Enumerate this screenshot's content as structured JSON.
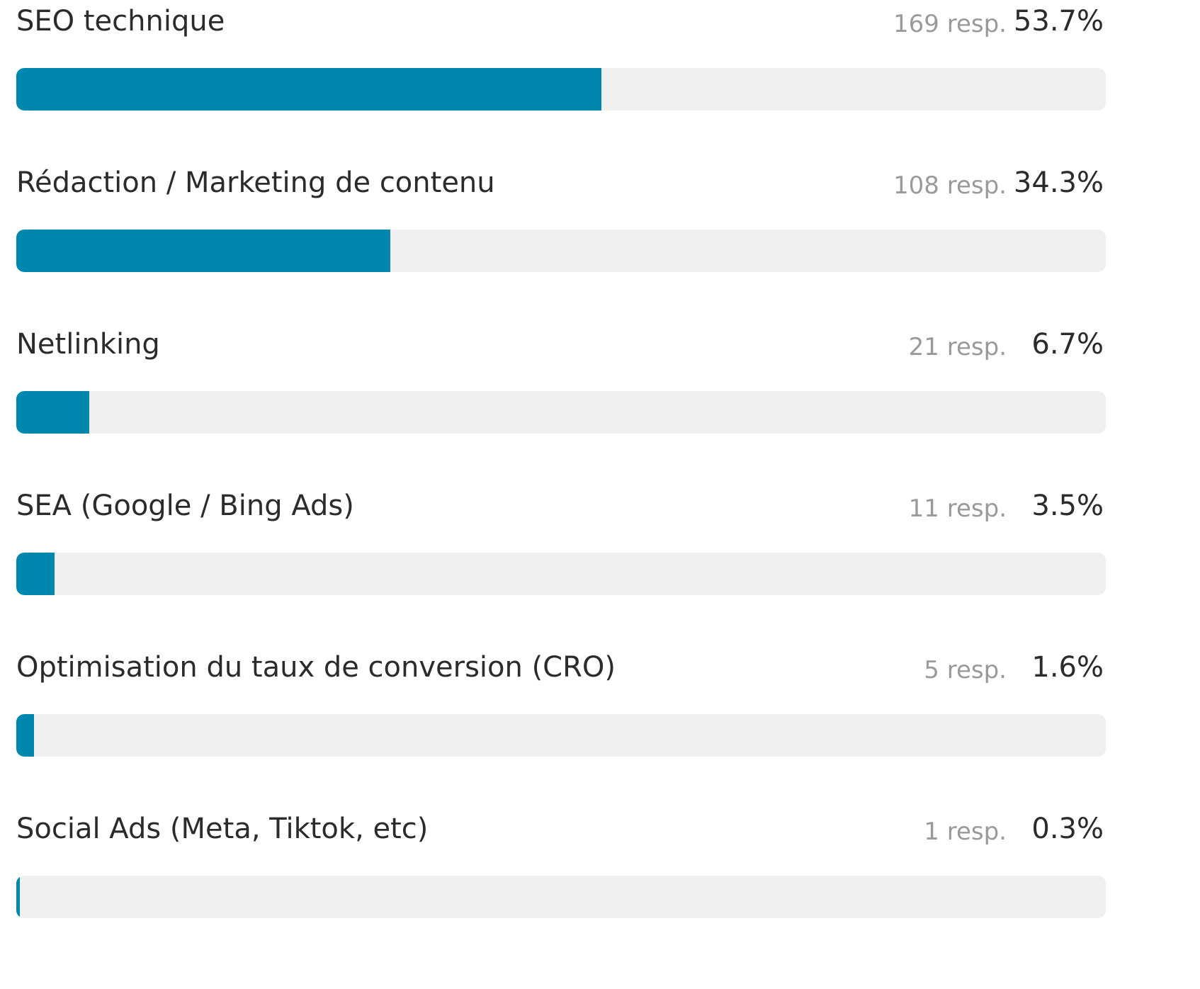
{
  "chart_data": {
    "type": "bar",
    "orientation": "horizontal",
    "bar_color": "#0087ae",
    "track_color": "#f0f0f0",
    "categories": [
      "SEO technique",
      "Rédaction / Marketing de contenu",
      "Netlinking",
      "SEA (Google / Bing Ads)",
      "Optimisation du taux de conversion (CRO)",
      "Social Ads (Meta, Tiktok, etc)"
    ],
    "responses": [
      169,
      108,
      21,
      11,
      5,
      1
    ],
    "values": [
      53.7,
      34.3,
      6.7,
      3.5,
      1.6,
      0.3
    ],
    "response_labels": [
      "169 resp.",
      "108 resp.",
      "21 resp.",
      "11 resp.",
      "5 resp.",
      "1 resp."
    ],
    "percent_labels": [
      "53.7%",
      "34.3%",
      "6.7%",
      "3.5%",
      "1.6%",
      "0.3%"
    ],
    "xlim": [
      0,
      100
    ]
  }
}
